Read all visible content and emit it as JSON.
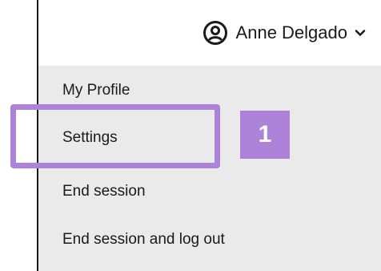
{
  "header": {
    "user_name": "Anne Delgado",
    "user_icon": "user-circle-icon",
    "dropdown_icon": "chevron-down-icon"
  },
  "menu": {
    "items": [
      {
        "label": "My Profile"
      },
      {
        "label": "Settings"
      },
      {
        "label": "End session"
      },
      {
        "label": "End session and log out"
      }
    ]
  },
  "annotation": {
    "step_number": "1",
    "color": "#ad82d9"
  },
  "colors": {
    "menu_background": "#eaeaea",
    "text": "#1a1a1a"
  }
}
